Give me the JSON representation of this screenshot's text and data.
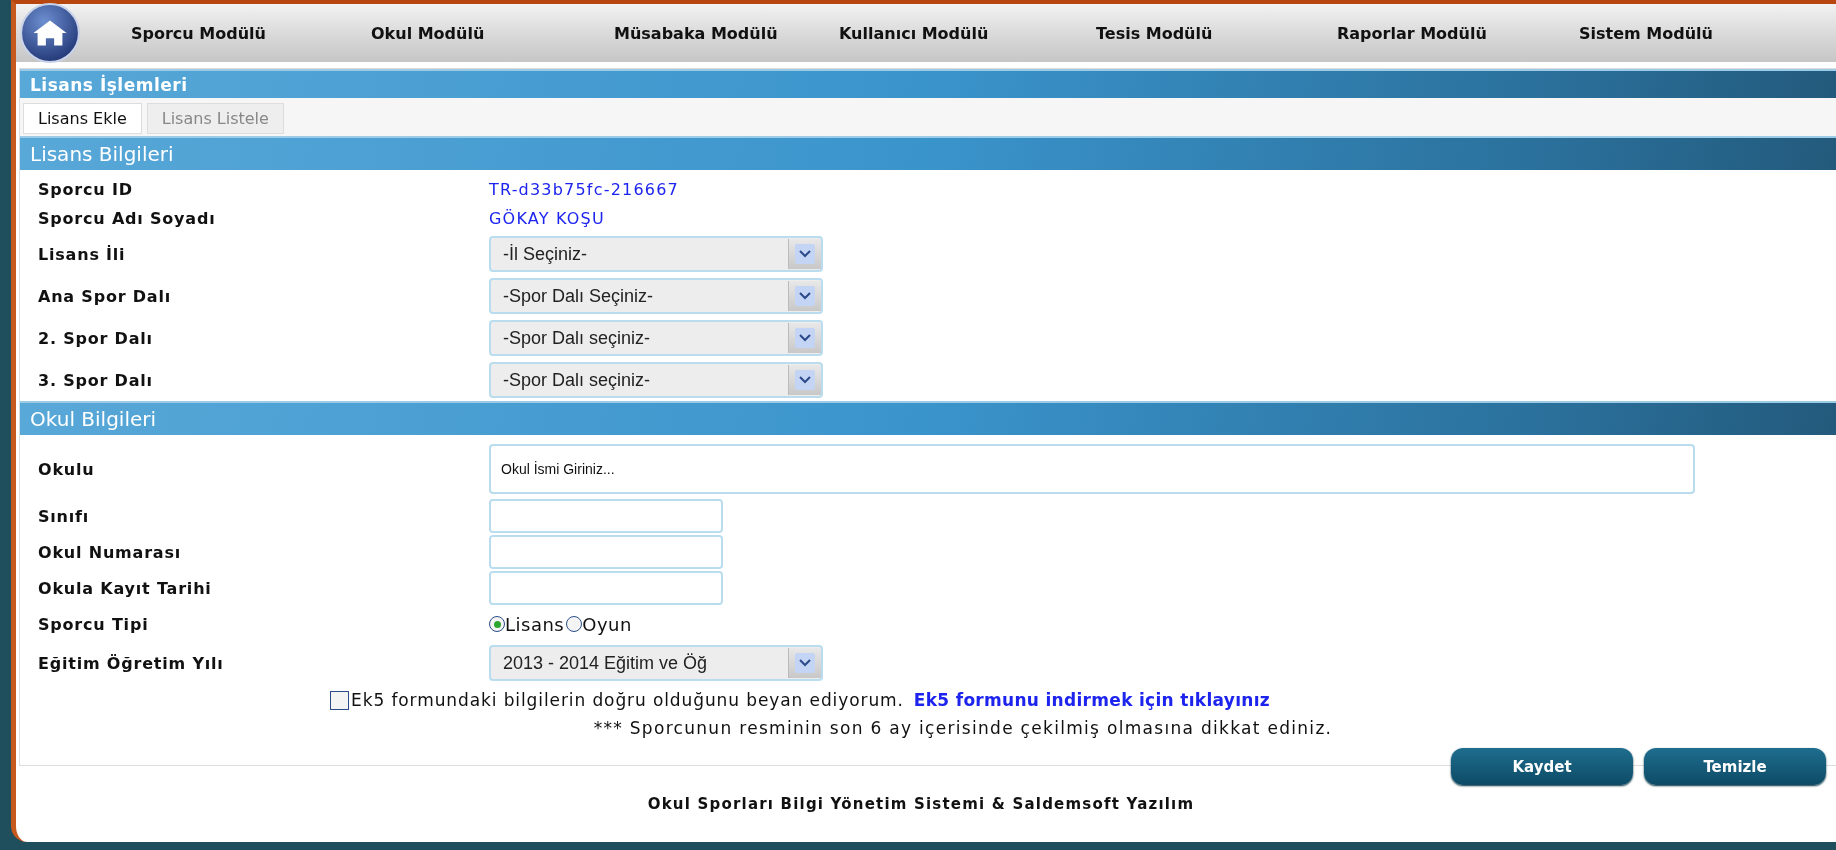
{
  "nav": {
    "items": [
      "Sporcu Modülü",
      "Okul Modülü",
      "Müsabaka Modülü",
      "Kullanıcı Modülü",
      "Tesis Modülü",
      "Raporlar Modülü",
      "Sistem Modülü"
    ]
  },
  "page_title": "Lisans İşlemleri",
  "tabs": [
    {
      "label": "Lisans Ekle",
      "selected": true
    },
    {
      "label": "Lisans Listele",
      "selected": false
    }
  ],
  "license_section": {
    "title": "Lisans Bilgileri",
    "rows": [
      {
        "kind": "text",
        "label": "Sporcu ID",
        "value": "TR-d33b75fc-216667"
      },
      {
        "kind": "text",
        "label": "Sporcu Adı Soyadı",
        "value": "GÖKAY KOŞU"
      },
      {
        "kind": "select",
        "label": "Lisans İli",
        "value": "-İl Seçiniz-"
      },
      {
        "kind": "select",
        "label": "Ana Spor Dalı",
        "value": "-Spor Dalı Seçiniz-"
      },
      {
        "kind": "select",
        "label": "2. Spor Dalı",
        "value": "-Spor Dalı seçiniz-"
      },
      {
        "kind": "select",
        "label": "3. Spor Dalı",
        "value": "-Spor Dalı seçiniz-"
      }
    ]
  },
  "school_section": {
    "title": "Okul Bilgileri",
    "rows": [
      {
        "kind": "wide_input",
        "label": "Okulu",
        "value": "Okul İsmi Giriniz..."
      },
      {
        "kind": "input",
        "label": "Sınıfı"
      },
      {
        "kind": "input",
        "label": "Okul Numarası"
      },
      {
        "kind": "input",
        "label": "Okula Kayıt Tarihi"
      },
      {
        "kind": "radio",
        "label": "Sporcu Tipi",
        "options": [
          {
            "label": "Lisans",
            "selected": true
          },
          {
            "label": "Oyun",
            "selected": false
          }
        ]
      },
      {
        "kind": "select",
        "label": "Eğitim Öğretim Yılı",
        "value": "2013 - 2014 Eğitim ve Öğ"
      }
    ]
  },
  "declaration": {
    "checked": false,
    "text": "Ek5 formundaki bilgilerin doğru olduğunu beyan ediyorum.",
    "link": "Ek5 formunu indirmek için tıklayınız"
  },
  "notice": "*** Sporcunun resminin son 6 ay içerisinde çekilmiş olmasına dikkat ediniz.",
  "buttons": [
    "Kaydet",
    "Temizle"
  ],
  "footer": "Okul Sporları Bilgi Yönetim Sistemi & Saldemsoft Yazılım"
}
